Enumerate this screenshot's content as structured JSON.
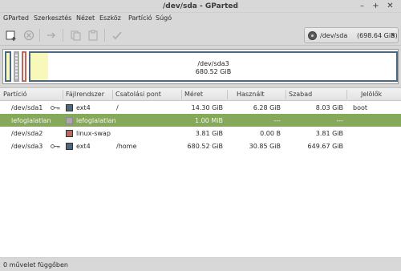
{
  "window": {
    "title": "/dev/sda - GParted",
    "minimize_glyph": "–",
    "maximize_glyph": "+",
    "close_glyph": "✕"
  },
  "menu": [
    "GParted",
    "Szerkesztés",
    "Nézet",
    "Eszköz",
    "Partíció",
    "Súgó"
  ],
  "toolbar": {
    "buttons": [
      "new-partition-icon",
      "delete-icon",
      "resize-move-icon",
      "copy-icon",
      "paste-icon",
      "apply-icon"
    ],
    "device": "/dev/sda",
    "device_size": "(698.64 GiB)",
    "dropdown_glyph": "▾"
  },
  "diskmap": {
    "main_label": "/dev/sda3",
    "main_size": "680.52 GiB",
    "colors": {
      "ext4": "#4b6983",
      "swap": "#c1665a",
      "unallocated": "#a9a9a9",
      "used": "#f8f8ba"
    }
  },
  "table": {
    "headers": [
      "Partíció",
      "Fájlrendszer",
      "Csatolási pont",
      "Méret",
      "Használt",
      "Szabad",
      "Jelölők"
    ],
    "rows": [
      {
        "partition": "/dev/sda1",
        "mounted": true,
        "fs": "ext4",
        "fs_color": "#4b6983",
        "mount": "/",
        "size": "14.30 GiB",
        "used": "6.28 GiB",
        "free": "8.03 GiB",
        "flags": "boot",
        "selected": false
      },
      {
        "partition": "lefoglalatlan",
        "mounted": false,
        "fs": "lefoglalatlan",
        "fs_color": "#a9a9a9",
        "mount": "",
        "size": "1.00 MiB",
        "used": "---",
        "free": "---",
        "flags": "",
        "selected": true
      },
      {
        "partition": "/dev/sda2",
        "mounted": false,
        "fs": "linux-swap",
        "fs_color": "#c1665a",
        "mount": "",
        "size": "3.81 GiB",
        "used": "0.00 B",
        "free": "3.81 GiB",
        "flags": "",
        "selected": false
      },
      {
        "partition": "/dev/sda3",
        "mounted": true,
        "fs": "ext4",
        "fs_color": "#4b6983",
        "mount": "/home",
        "size": "680.52 GiB",
        "used": "30.85 GiB",
        "free": "649.67 GiB",
        "flags": "",
        "selected": false
      }
    ]
  },
  "status": "0 művelet függőben"
}
